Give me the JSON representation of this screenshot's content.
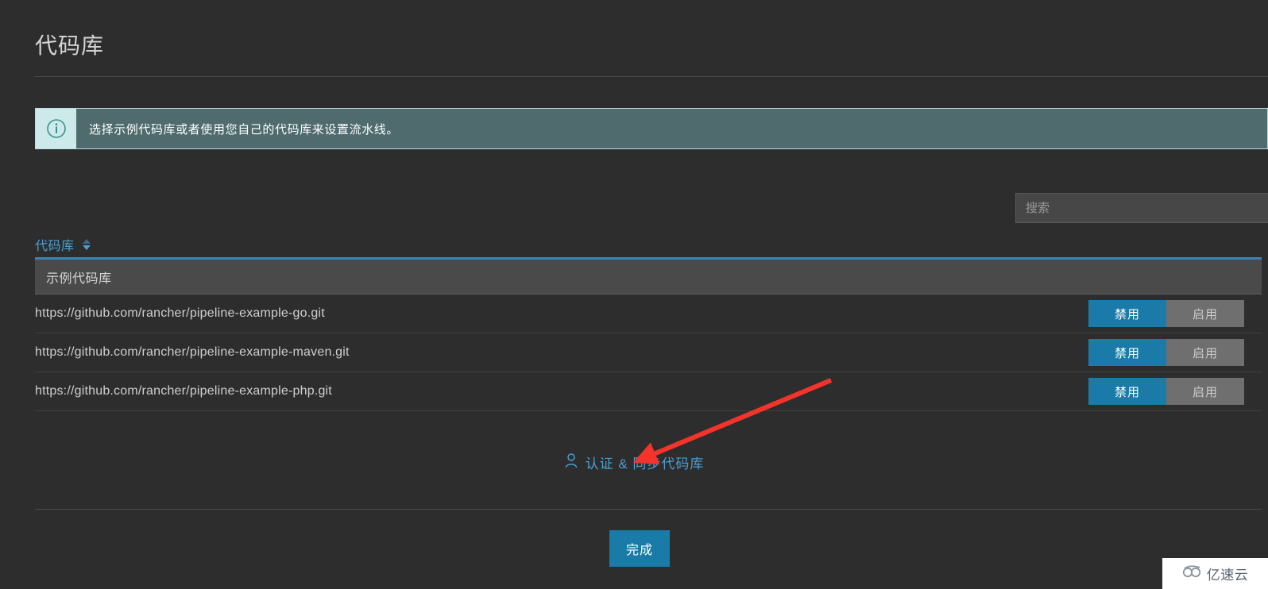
{
  "header": {
    "title": "代码库"
  },
  "banner": {
    "icon": "info-circle-icon",
    "message": "选择示例代码库或者使用您自己的代码库来设置流水线。",
    "bg_color": "#4f6b6e",
    "icon_bg_color": "#cdeaea",
    "border_color": "#b9dcdc"
  },
  "search": {
    "placeholder": "搜索",
    "value": ""
  },
  "table": {
    "column_header": "代码库",
    "sort_icon": "sort-chevrons-icon",
    "header_color": "#4a9fd4",
    "group_label": "示例代码库",
    "rows": [
      {
        "url": "https://github.com/rancher/pipeline-example-go.git",
        "disable_label": "禁用",
        "enable_label": "启用",
        "state": "disabled"
      },
      {
        "url": "https://github.com/rancher/pipeline-example-maven.git",
        "disable_label": "禁用",
        "enable_label": "启用",
        "state": "disabled"
      },
      {
        "url": "https://github.com/rancher/pipeline-example-php.git",
        "disable_label": "禁用",
        "enable_label": "启用",
        "state": "disabled"
      }
    ]
  },
  "auth_link": {
    "icon": "user-icon",
    "label": "认证 & 同步代码库",
    "color": "#4a9fd4"
  },
  "footer": {
    "done_label": "完成",
    "accent_color": "#1b7ba8"
  },
  "annotation": {
    "type": "red-arrow",
    "color": "#f4342b"
  },
  "watermark": {
    "icon": "cloud-logo-icon",
    "text": "亿速云"
  }
}
